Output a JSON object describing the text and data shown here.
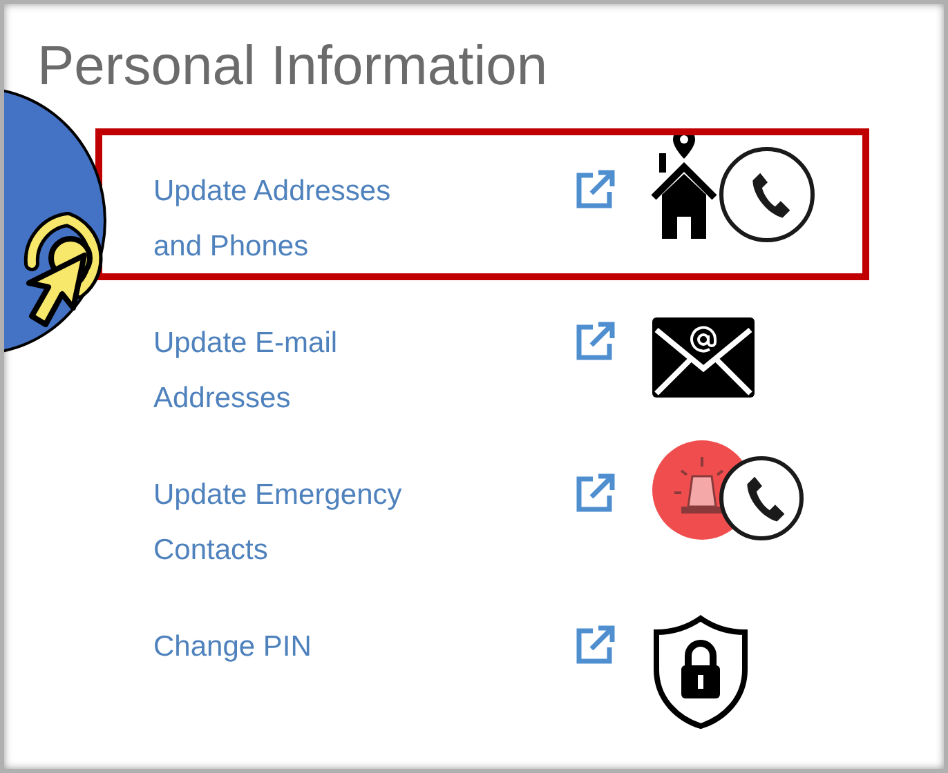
{
  "title": "Personal Information",
  "links": [
    {
      "lines": [
        "Update Addresses",
        "and Phones"
      ],
      "kind": "home-phone",
      "highlighted": true
    },
    {
      "lines": [
        "Update E-mail",
        "Addresses"
      ],
      "kind": "email",
      "highlighted": false
    },
    {
      "lines": [
        "Update Emergency",
        "Contacts"
      ],
      "kind": "emergency-phone",
      "highlighted": false
    },
    {
      "lines": [
        "Change PIN"
      ],
      "kind": "lock",
      "highlighted": false
    }
  ]
}
